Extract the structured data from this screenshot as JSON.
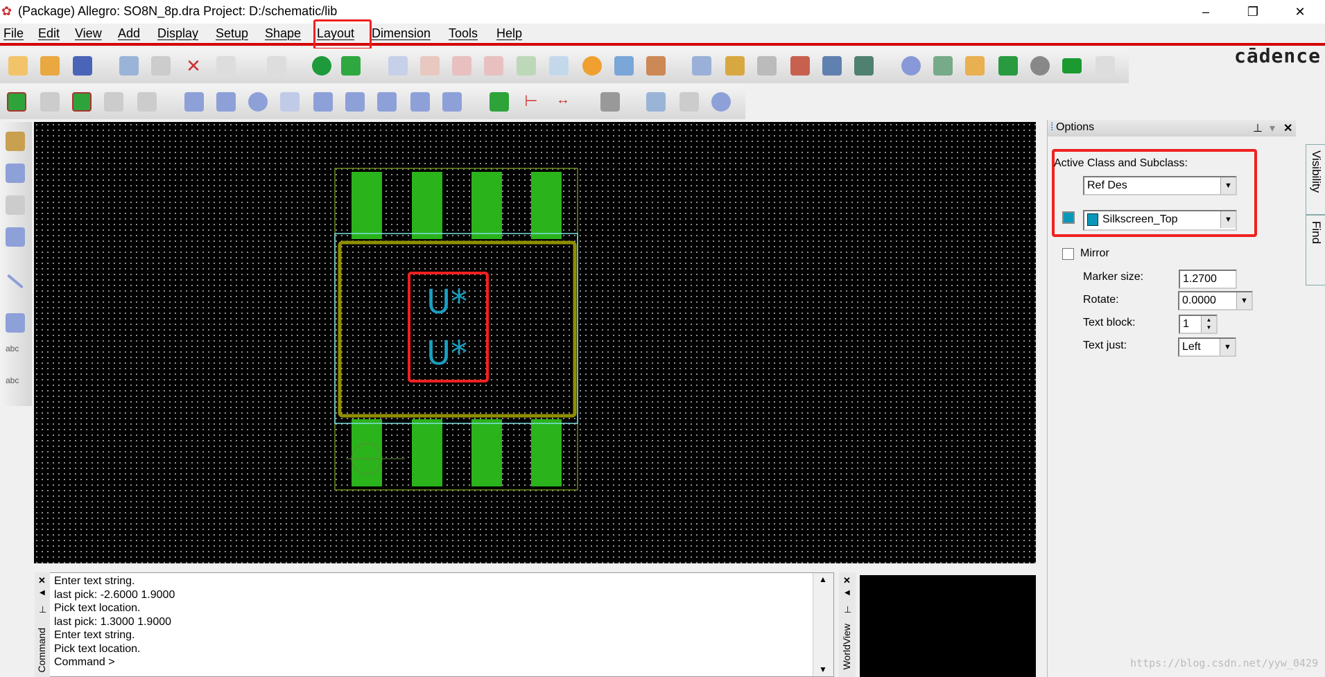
{
  "window": {
    "title": "(Package) Allegro: SO8N_8p.dra  Project: D:/schematic/lib",
    "minimize": "–",
    "restore": "❐",
    "close": "✕"
  },
  "menu": {
    "items": [
      {
        "label": "File"
      },
      {
        "label": "Edit"
      },
      {
        "label": "View"
      },
      {
        "label": "Add"
      },
      {
        "label": "Display"
      },
      {
        "label": "Setup"
      },
      {
        "label": "Shape"
      },
      {
        "label": "Layout"
      },
      {
        "label": "Dimension"
      },
      {
        "label": "Tools"
      },
      {
        "label": "Help"
      }
    ],
    "highlighted": "Layout"
  },
  "brand": "cādence",
  "canvas": {
    "refdes_top": "U*",
    "refdes_bottom": "U*",
    "pad_color": "#2bb31c",
    "body_color": "#8f8f00",
    "refdes_color": "#1aa0c0"
  },
  "options": {
    "title": "Options",
    "pin": "⊥",
    "dropdown": "▾",
    "close": "✕",
    "active_class_label": "Active Class and Subclass:",
    "class_value": "Ref Des",
    "subclass_value": "Silkscreen_Top",
    "subclass_color": "#0a98b8",
    "mirror_label": "Mirror",
    "mirror_checked": false,
    "marker_size_label": "Marker size:",
    "marker_size": "1.2700",
    "rotate_label": "Rotate:",
    "rotate": "0.0000",
    "text_block_label": "Text block:",
    "text_block": "1",
    "text_just_label": "Text just:",
    "text_just": "Left"
  },
  "side_tabs": {
    "visibility": "Visibility",
    "find": "Find"
  },
  "command": {
    "tab": "Command",
    "lines": [
      "Enter text string.",
      "last pick:  -2.6000  1.9000",
      "Pick text location.",
      "last pick:  1.3000  1.9000",
      "Enter text string.",
      "Pick text location.",
      "Command >"
    ]
  },
  "worldview": {
    "tab": "WorldView"
  },
  "watermark": "https://blog.csdn.net/yyw_0429"
}
